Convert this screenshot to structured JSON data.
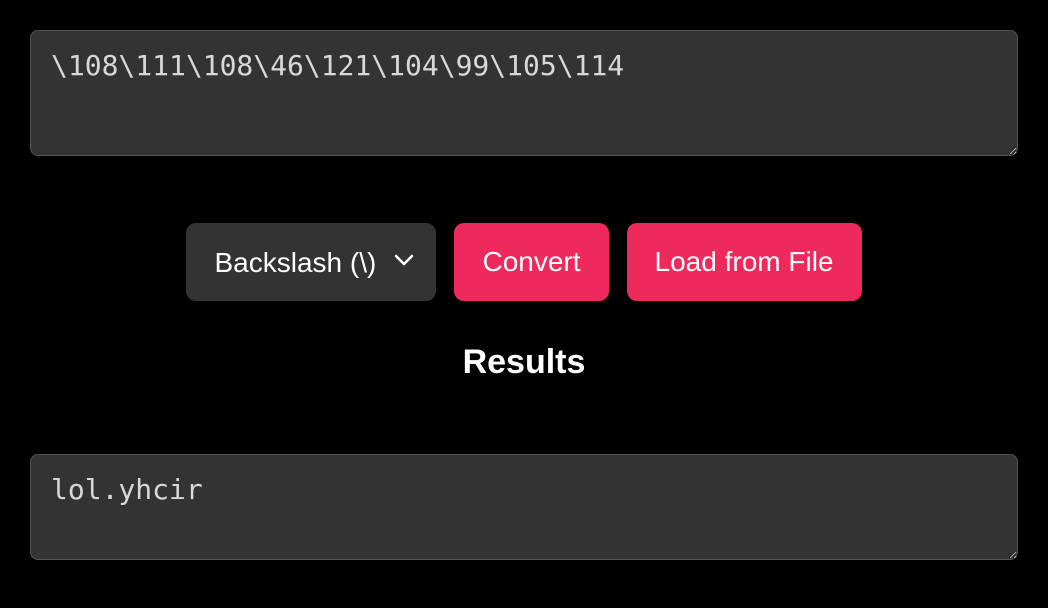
{
  "input": {
    "value": "\\108\\111\\108\\46\\121\\104\\99\\105\\114"
  },
  "controls": {
    "format_selected": "Backslash (\\)",
    "convert_label": "Convert",
    "load_label": "Load from File"
  },
  "results": {
    "heading": "Results",
    "value": "lol.yhcir"
  },
  "colors": {
    "accent": "#ed2a5b",
    "panel": "#333333",
    "bg": "#000000"
  }
}
